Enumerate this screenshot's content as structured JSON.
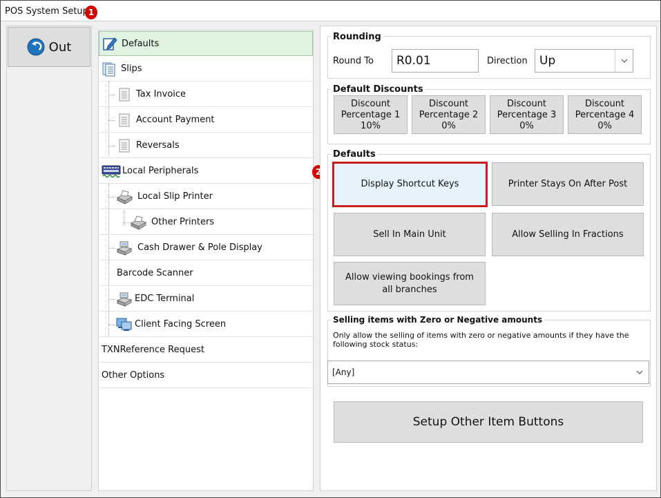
{
  "window": {
    "title": "POS System Setup"
  },
  "markers": {
    "m1": "1",
    "m2": "2"
  },
  "leftbar": {
    "out_label": "Out"
  },
  "tree": {
    "items": [
      {
        "label": "Defaults",
        "icon": "edit-icon"
      },
      {
        "label": "Slips",
        "icon": "slips-icon"
      },
      {
        "label": "Tax Invoice",
        "icon": "document-icon"
      },
      {
        "label": "Account Payment",
        "icon": "document-icon"
      },
      {
        "label": "Reversals",
        "icon": "document-icon"
      },
      {
        "label": "Local Peripherals",
        "icon": "keyboard-icon"
      },
      {
        "label": "Local Slip Printer",
        "icon": "printer-icon"
      },
      {
        "label": "Other Printers",
        "icon": "printer-icon"
      },
      {
        "label": "Cash Drawer & Pole Display",
        "icon": "cash-register-icon"
      },
      {
        "label": "Barcode Scanner"
      },
      {
        "label": "EDC Terminal",
        "icon": "cash-register-icon"
      },
      {
        "label": "Client Facing Screen",
        "icon": "monitor-icon"
      },
      {
        "label": "TXNReference Request"
      },
      {
        "label": "Other Options"
      }
    ]
  },
  "rounding": {
    "title": "Rounding",
    "round_to_label": "Round To",
    "round_to_value": "R0.01",
    "direction_label": "Direction",
    "direction_value": "Up"
  },
  "discounts": {
    "title": "Default Discounts",
    "buttons": [
      {
        "line1": "Discount",
        "line2": "Percentage 1",
        "value": "10%"
      },
      {
        "line1": "Discount",
        "line2": "Percentage 2",
        "value": "0%"
      },
      {
        "line1": "Discount",
        "line2": "Percentage 3",
        "value": "0%"
      },
      {
        "line1": "Discount",
        "line2": "Percentage 4",
        "value": "0%"
      }
    ]
  },
  "defaults": {
    "title": "Defaults",
    "display_shortcut_keys": "Display Shortcut Keys",
    "printer_stays_on": "Printer Stays On After Post",
    "sell_in_main_unit": "Sell In Main Unit",
    "allow_selling_fractions": "Allow Selling In Fractions",
    "allow_viewing_line1": "Allow viewing bookings from",
    "allow_viewing_line2": "all branches"
  },
  "zero_negative": {
    "title": "Selling items with Zero or Negative amounts",
    "desc_line1": "Only allow the selling of items with zero or negative amounts if they have the",
    "desc_line2": "following stock status:",
    "status_value": "[Any]"
  },
  "setup_other": {
    "label": "Setup Other Item Buttons"
  },
  "colors": {
    "accent_red": "#cc1b1b",
    "selected_green": "#dff3e0",
    "button_gray": "#dedede",
    "out_blue": "#1e73be"
  }
}
